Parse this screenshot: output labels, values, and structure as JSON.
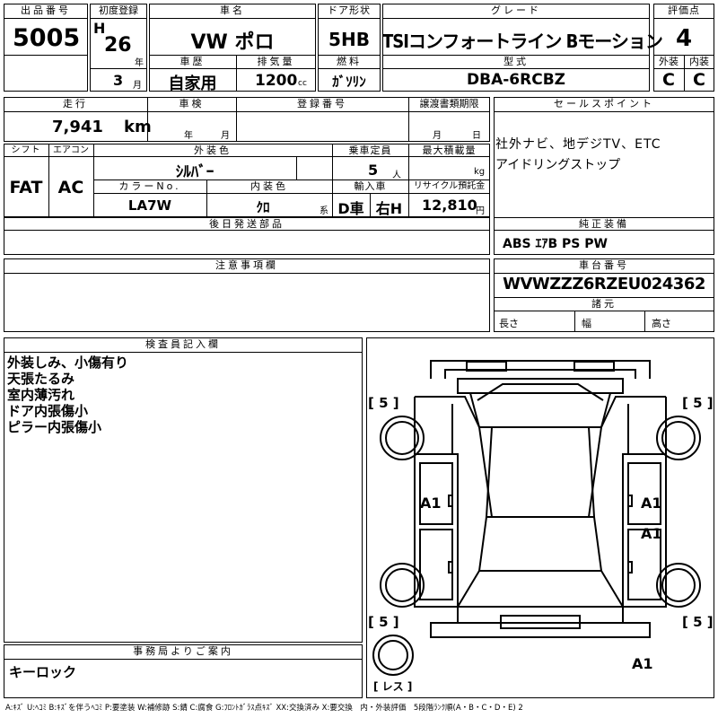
{
  "header": {
    "lot_no_label": "出品番号",
    "lot_no": "5005",
    "first_reg_label": "初度登録",
    "era": "H",
    "year": "26",
    "year_unit": "年",
    "month": "3",
    "month_unit": "月",
    "car_name_label": "車名",
    "car_name": "VW ポロ",
    "door_label": "ドア形状",
    "door": "5HB",
    "grade_label": "グレード",
    "grade": "TSIコンフォートライン Bモーション",
    "score_label": "評価点",
    "score": "4",
    "history_label": "車歴",
    "history": "自家用",
    "displacement_label": "排気量",
    "displacement": "1200",
    "displacement_unit": "cc",
    "fuel_label": "燃料",
    "fuel": "ｶﾞｿﾘﾝ",
    "model_label": "型式",
    "model": "DBA-6RCBZ",
    "ext_label": "外装",
    "ext_grade": "C",
    "int_label": "内装",
    "int_grade": "C"
  },
  "row2": {
    "mileage_label": "走行",
    "mileage": "7,941",
    "mileage_unit": "km",
    "inspection_label": "車検",
    "inspection_year_unit": "年",
    "inspection_month_unit": "月",
    "regno_label": "登録番号",
    "transfer_label": "譲渡書類期限",
    "transfer_month_unit": "月",
    "transfer_day_unit": "日",
    "sales_label": "セールスポイント",
    "sales_points": [
      "社外ナビ、地デジTV、ETC",
      "アイドリングストップ"
    ]
  },
  "row3": {
    "shift_label": "シフト",
    "shift": "FAT",
    "ac_label": "エアコン",
    "ac": "AC",
    "exterior_color_label": "外装色",
    "exterior_color": "ｼﾙﾊﾞｰ",
    "capacity_label": "乗車定員",
    "capacity": "5",
    "capacity_unit": "人",
    "max_load_label": "最大積載量",
    "max_load_unit": "kg",
    "color_no_label": "カラーNo.",
    "color_no": "LA7W",
    "interior_color_label": "内装色",
    "interior_color": "ｸﾛ",
    "interior_color_unit": "系",
    "import_label": "輸入車",
    "import_d": "D車",
    "import_side": "右H",
    "recycle_label": "リサイクル預託金",
    "recycle": "12,810",
    "recycle_unit": "円"
  },
  "later_parts_label": "後日発送部品",
  "equipment_label": "純正装備",
  "equipment": "ABS ｴｱB PS PW",
  "caution_label": "注意事項欄",
  "chassis_label": "車台番号",
  "chassis": "WVWZZZ6RZEU024362",
  "specs_label": "諸元",
  "length_label": "長さ",
  "width_label": "幅",
  "height_label": "高さ",
  "inspector_label": "検査員記入欄",
  "inspector_notes": [
    "外装しみ、小傷有り",
    "天張たるみ",
    "室内薄汚れ",
    "ドア内張傷小",
    "ピラー内張傷小"
  ],
  "office_label": "事務局よりご案内",
  "office_note": "キーロック",
  "diagram": {
    "tire_fl": "[ 5 ]",
    "tire_fr": "[ 5 ]",
    "tire_rl": "[ 5 ]",
    "tire_rr": "[ 5 ]",
    "mark_left_door": "A1",
    "mark_right_front": "A1",
    "mark_right_rear": "A1",
    "mark_spare": "A1",
    "spare_label": "[ レス ]"
  },
  "legend": "A:ｷｽﾞ U:ﾍｺﾐ B:ｷｽﾞを伴うﾍｺﾐ P:要塗装 W:補修跡 S:錆 C:腐食 G:ﾌﾛﾝﾄｶﾞﾗｽ点ｷｽﾞ XX:交換済み X:要交換　内・外装評価　5段階ﾗﾝｸ順(A・B・C・D・E) 2"
}
